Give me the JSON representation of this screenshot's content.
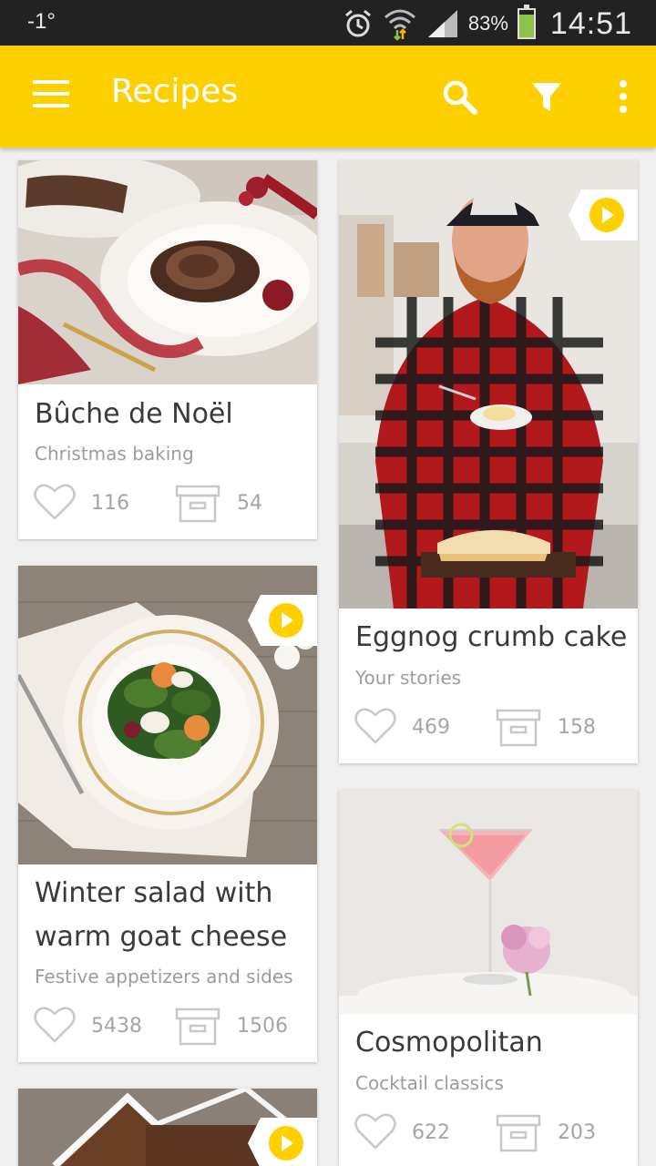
{
  "status_bar": {
    "temperature": "-1°",
    "battery": "83%",
    "time": "14:51",
    "battery_level": 0.83
  },
  "app_bar": {
    "title": "Recipes"
  },
  "icons": {
    "menu": "menu-icon",
    "search": "search-icon",
    "filter": "filter-icon",
    "more": "more-vert-icon",
    "like": "heart-icon",
    "save": "archive-box-icon",
    "play": "play-icon"
  },
  "colors": {
    "accent": "#ffd000",
    "play_badge": "#ffd000",
    "status_bar": "#222222",
    "background": "#efefef"
  },
  "recipes": [
    {
      "title": "Bûche de Noël",
      "category": "Christmas baking",
      "likes": "116",
      "saves": "54",
      "video": false
    },
    {
      "title": "Eggnog crumb cake",
      "category": "Your stories",
      "likes": "469",
      "saves": "158",
      "video": true
    },
    {
      "title_line1": "Winter salad with",
      "title_line2": "warm goat cheese",
      "category": "Festive appetizers and sides",
      "likes": "5438",
      "saves": "1506",
      "video": true
    },
    {
      "title": "Cosmopolitan",
      "category": "Cocktail classics",
      "likes": "622",
      "saves": "203",
      "video": false
    },
    {
      "video": true
    }
  ]
}
